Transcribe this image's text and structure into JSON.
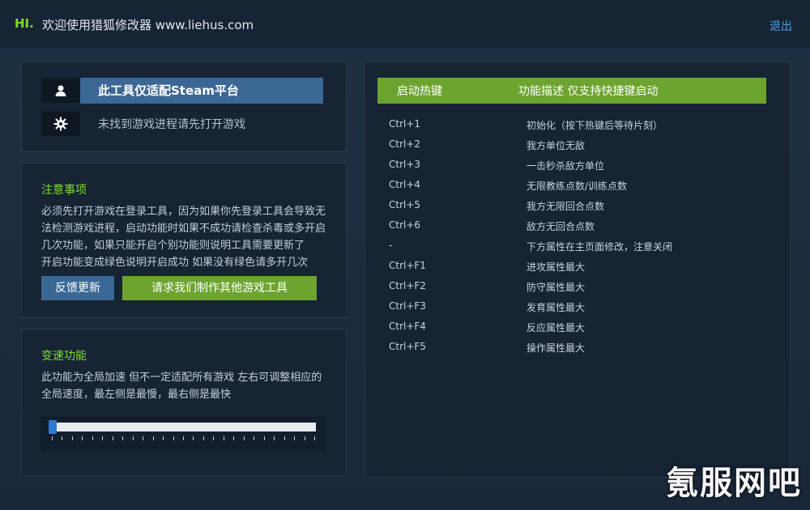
{
  "titlebar": {
    "hi": "HI.",
    "title": "欢迎使用猎狐修改器 www.liehus.com",
    "logout": "退出"
  },
  "status": {
    "platform": "此工具仅适配Steam平台",
    "process": "未找到游戏进程请先打开游戏",
    "platform_icon": "user-icon",
    "process_icon": "gear-icon"
  },
  "notice": {
    "title": "注意事项",
    "lines": [
      "必须先打开游戏在登录工具，因为如果你先登录工具会导致无",
      "法检测游戏进程，启动功能时如果不成功请检查杀毒或多开启",
      "几次功能，如果只能开启个别功能则说明工具需要更新了",
      "开启功能变成绿色说明开启成功 如果没有绿色请多开几次"
    ],
    "feedback_button": "反馈更新",
    "request_button": "请求我们制作其他游戏工具"
  },
  "speed": {
    "title": "变速功能",
    "lines": [
      "此功能为全局加速 但不一定适配所有游戏 左右可调整相应的",
      "全局速度，最左侧是最慢，最右侧是最快"
    ],
    "slider_value": 0
  },
  "hotkeys": {
    "header_key": "启动热键",
    "header_desc": "功能描述 仅支持快捷键启动",
    "rows": [
      {
        "key": "Ctrl+1",
        "desc": "初始化（按下热键后等待片刻）"
      },
      {
        "key": "Ctrl+2",
        "desc": "我方单位无敌"
      },
      {
        "key": "Ctrl+3",
        "desc": "一击秒杀敌方单位"
      },
      {
        "key": "Ctrl+4",
        "desc": "无限教练点数/训练点数"
      },
      {
        "key": "Ctrl+5",
        "desc": "我方无限回合点数"
      },
      {
        "key": "Ctrl+6",
        "desc": "敌方无回合点数"
      },
      {
        "key": "-",
        "desc": "下方属性在主页面修改，注意关闭"
      },
      {
        "key": "Ctrl+F1",
        "desc": "进攻属性最大"
      },
      {
        "key": "Ctrl+F2",
        "desc": "防守属性最大"
      },
      {
        "key": "Ctrl+F3",
        "desc": "发育属性最大"
      },
      {
        "key": "Ctrl+F4",
        "desc": "反应属性最大"
      },
      {
        "key": "Ctrl+F5",
        "desc": "操作属性最大"
      }
    ]
  },
  "watermark": "氪服网吧",
  "colors": {
    "accent_green": "#6ca42f",
    "accent_blue": "#3a6895",
    "highlight_green": "#7ddc2e",
    "link_blue": "#4aa0e6"
  }
}
